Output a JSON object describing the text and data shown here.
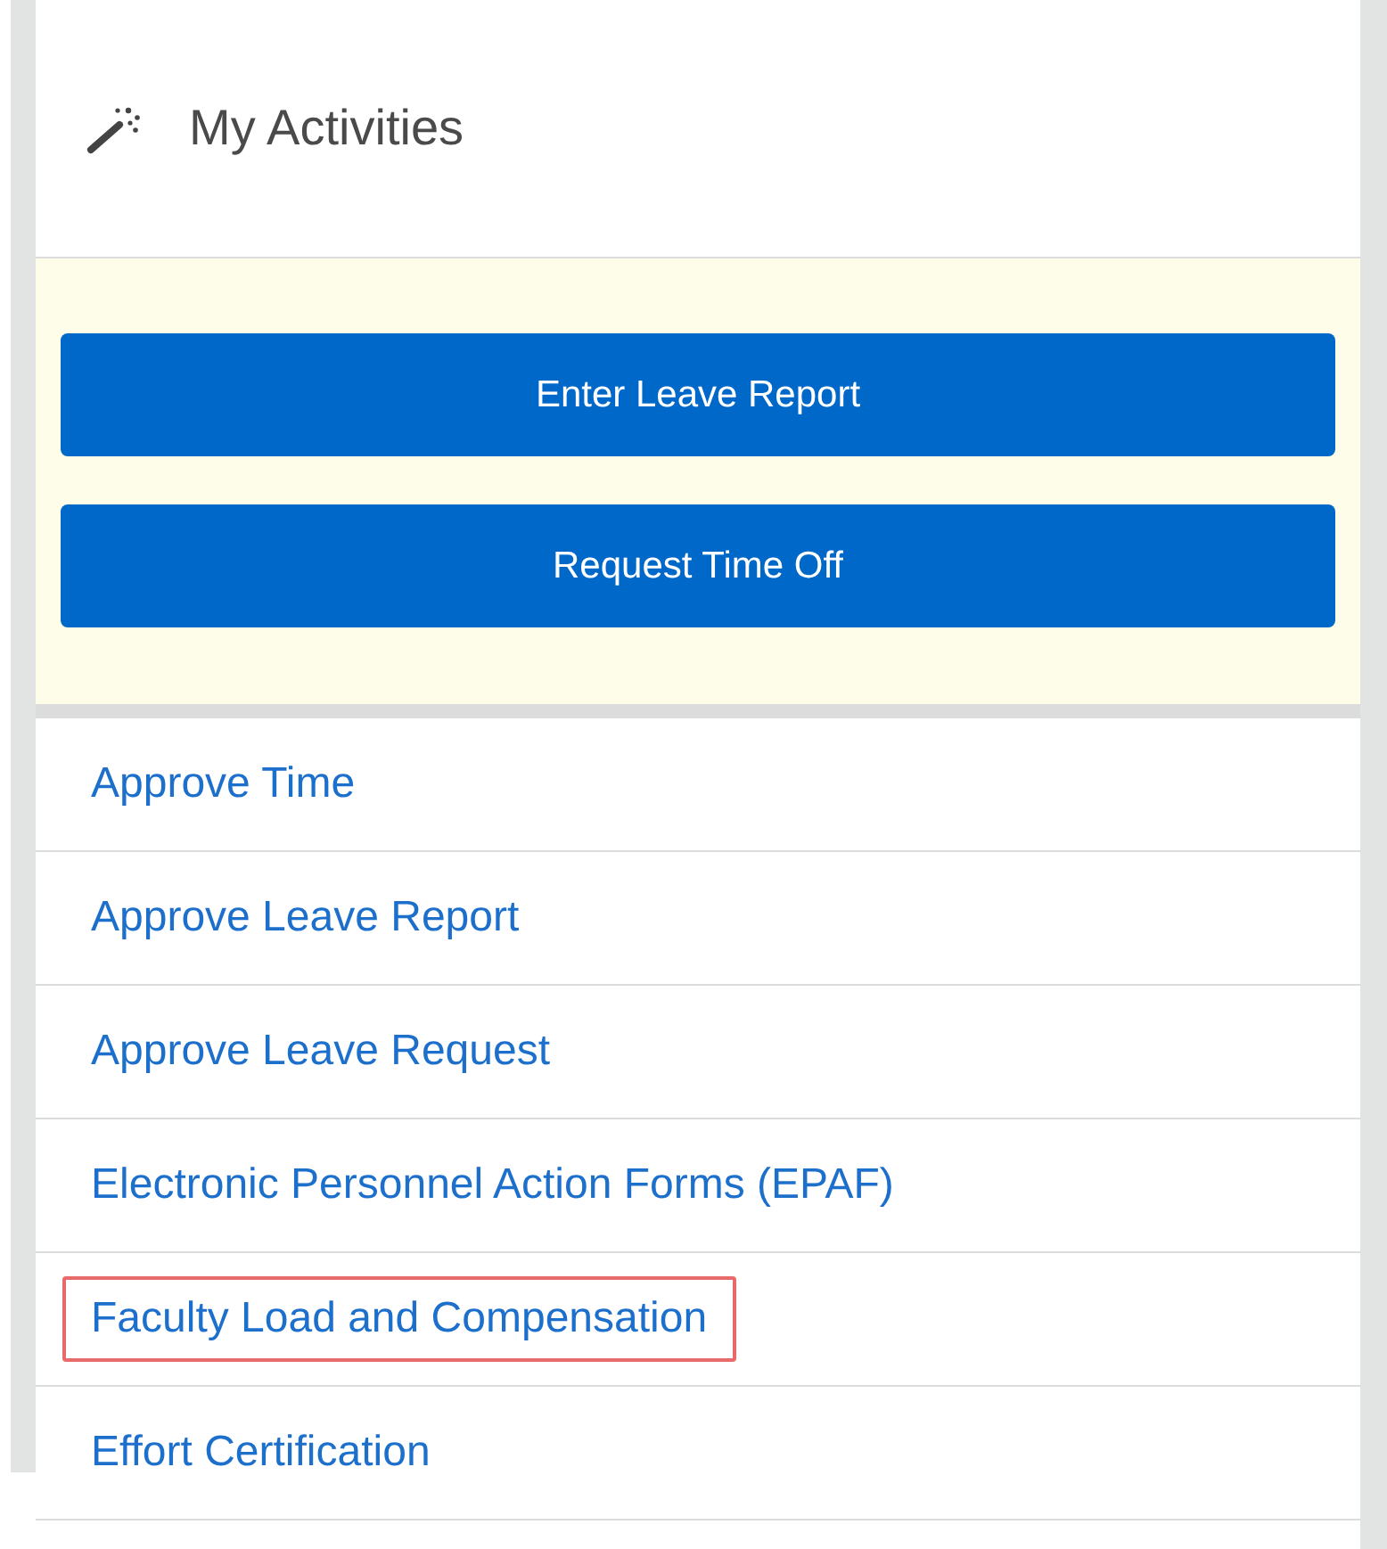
{
  "panel": {
    "title": "My Activities"
  },
  "buttons": [
    "Enter Leave Report",
    "Request Time Off"
  ],
  "links": [
    {
      "label": "Approve Time",
      "highlighted": false
    },
    {
      "label": "Approve Leave Report",
      "highlighted": false
    },
    {
      "label": "Approve Leave Request",
      "highlighted": false
    },
    {
      "label": "Electronic Personnel Action Forms (EPAF)",
      "highlighted": false
    },
    {
      "label": "Faculty Load and Compensation",
      "highlighted": true
    },
    {
      "label": "Effort Certification",
      "highlighted": false
    }
  ]
}
